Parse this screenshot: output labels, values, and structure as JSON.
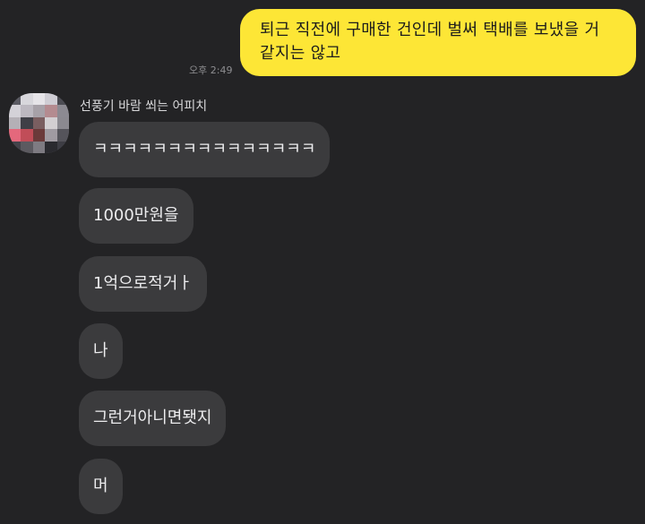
{
  "conversation": {
    "outgoing": {
      "line1": "퇴근 직전에 구매한 건인데 벌써 택배를 보냈을 거",
      "line2": "같지는 않고",
      "time": "오후 2:49",
      "bubble_color": "#fde636"
    },
    "incoming": {
      "sender": "선풍기 바람 쐬는 어피치",
      "bubble_color": "#3b3b3d",
      "messages": [
        "ㅋㅋㅋㅋㅋㅋㅋㅋㅋㅋㅋㅋㅋㅋㅋ",
        "1000만원을",
        "1억으로적거ㅏ",
        "나",
        "그런거아니면됏지",
        "머"
      ]
    },
    "background_color": "#232325"
  }
}
